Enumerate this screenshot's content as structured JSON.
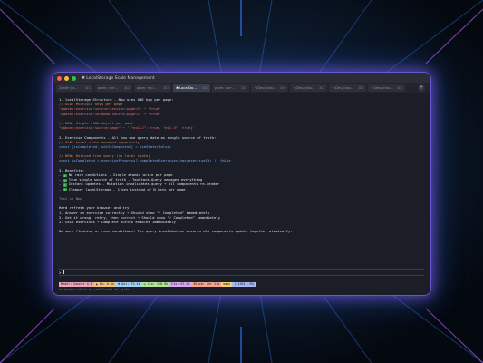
{
  "window": {
    "title": "✱ LocalStorage Scale Management"
  },
  "tabs": [
    {
      "label": "Zenith (Ja…",
      "shortcut": "⌘1",
      "active": false
    },
    {
      "label": "prom: curr…",
      "shortcut": "⌘2",
      "active": false
    },
    {
      "label": "prom: rep…",
      "shortcut": "⌘3",
      "active": false
    },
    {
      "label": "✱ LocalSto…",
      "shortcut": "⌘4",
      "active": true
    },
    {
      "label": "prom: curr…",
      "shortcut": "⌘5",
      "active": false
    },
    {
      "label": "~/Dev/(clau…",
      "shortcut": "⌘6",
      "active": false
    },
    {
      "label": "~/Dev/(clau…",
      "shortcut": "⌘7",
      "active": false
    },
    {
      "label": "~/Dev/(clau…",
      "shortcut": "⌘8",
      "active": false
    },
    {
      "label": "~/Dev/(clau…",
      "shortcut": "⌘9",
      "active": false
    }
  ],
  "content": {
    "s1_heading": "1. localStorage Structure",
    "s1_desc": " - Now uses ONE key per page:",
    "s1_c1": "// OLD: Multiple keys per page",
    "s1_k1": "\"gabsec:exercise:source:session:page=1\"",
    "s1_v1": " → \"true\"",
    "s1_k2": "\"gabsec:exercise:id:a66b:source:page=1\"",
    "s1_v2": " → \"true\"",
    "s1_c2": "// NEW: Single JSON object per page",
    "s1_k3": "\"gabsec:exercise:source:page\"",
    "s1_v3": " → '{\"ex1-2\": true, \"ex1-3\": true}'",
    "s2_heading": "2. Exercise Components",
    "s2_desc": " - All now use query data as single source of truth:",
    "s2_c1": "// OLD: Local state managed separately",
    "s2_code1": "const [isCompleted, setIsCompleted] = useState(false)",
    "s2_c2": "// NEW: Derived from query (no local state)",
    "s2_code2": "const isCompleted = exerciseProgress?.completedExercises.has(exerciseId) || false",
    "s3_heading": "3. Benefits:",
    "benefits": [
      {
        "title": "No race conditions",
        "desc": " - Single atomic write per page"
      },
      {
        "title": "True single source of truth",
        "desc": " - TanStack Query manages everything"
      },
      {
        "title": "Instant updates",
        "desc": " - Mutation invalidates query → all components re-render"
      },
      {
        "title": "Cleaner localStorage",
        "desc": " - 1 key instead of N keys per page"
      }
    ],
    "test_heading": "Test it Now",
    "test_intro": "Hard refresh your browser and try:",
    "steps": [
      "1. Answer an exercise correctly → Should show \"✓ Completed\" immediately",
      "2. Get it wrong, retry, then correct → Should show \"✓ Completed\" immediately",
      "3. Skip exercises → Complete button enables immediately"
    ],
    "closing": "No more flashing or race conditions! The query invalidation ensures all components update together atomically."
  },
  "prompt": {
    "caret": ">"
  },
  "statusbar": [
    "Model: Sonnet 4.5",
    "▲ In: 6.5k",
    "▼ Out: 75.4k",
    "◎ Ctx: 128.9k",
    "Ctx: 67.5%",
    "Block: 2hr 11m",
    "main",
    "(+1301,-49)"
  ],
  "hint": "▸▸ accept edits on (shift+tab to cycle)",
  "colors": {
    "accent_glow": "#9a5cff",
    "check_green": "#2f9f4a",
    "heading_white": "#e6e6ea",
    "comment": "#d08a54",
    "string": "#e0736a"
  }
}
